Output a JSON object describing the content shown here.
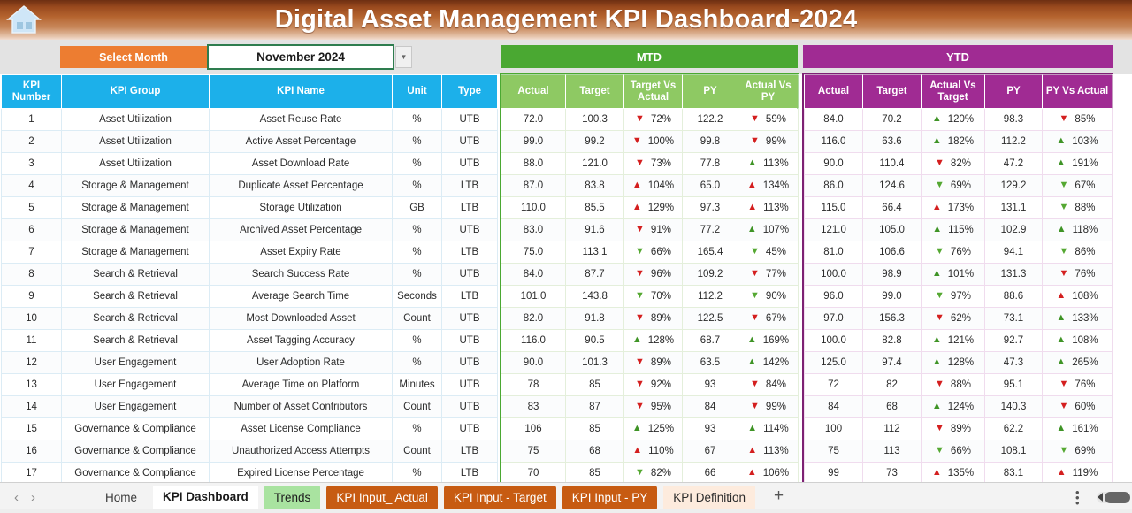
{
  "header": {
    "title": "Digital Asset Management KPI Dashboard-2024",
    "home_icon": "home-icon",
    "accent_color": "#b5642f"
  },
  "controls": {
    "select_month_label": "Select Month",
    "month_value": "November 2024",
    "dropdown_icon": "chevron-down-icon"
  },
  "groups": {
    "mtd": {
      "label": "MTD",
      "color": "#4aa832"
    },
    "ytd": {
      "label": "YTD",
      "color": "#a02b93"
    }
  },
  "left_headers": [
    "KPI Number",
    "KPI Group",
    "KPI Name",
    "Unit",
    "Type"
  ],
  "mtd_headers": [
    "Actual",
    "Target",
    "Target Vs Actual",
    "PY",
    "Actual Vs PY"
  ],
  "ytd_headers": [
    "Actual",
    "Target",
    "Actual Vs Target",
    "PY",
    "PY Vs Actual"
  ],
  "rows": [
    {
      "num": "1",
      "group": "Asset Utilization",
      "name": "Asset Reuse Rate",
      "unit": "%",
      "type": "UTB",
      "mtd": {
        "actual": "72.0",
        "target": "100.3",
        "tva": "72%",
        "tva_dir": "down",
        "tva_color": "red",
        "py": "122.2",
        "avp": "59%",
        "avp_dir": "down",
        "avp_color": "red"
      },
      "ytd": {
        "actual": "84.0",
        "target": "70.2",
        "avt": "120%",
        "avt_dir": "up",
        "avt_color": "green",
        "py": "98.3",
        "pva": "85%",
        "pva_dir": "down",
        "pva_color": "red"
      }
    },
    {
      "num": "2",
      "group": "Asset Utilization",
      "name": "Active Asset Percentage",
      "unit": "%",
      "type": "UTB",
      "mtd": {
        "actual": "99.0",
        "target": "99.2",
        "tva": "100%",
        "tva_dir": "down",
        "tva_color": "red",
        "py": "99.8",
        "avp": "99%",
        "avp_dir": "down",
        "avp_color": "red"
      },
      "ytd": {
        "actual": "116.0",
        "target": "63.6",
        "avt": "182%",
        "avt_dir": "up",
        "avt_color": "green",
        "py": "112.2",
        "pva": "103%",
        "pva_dir": "up",
        "pva_color": "green"
      }
    },
    {
      "num": "3",
      "group": "Asset Utilization",
      "name": "Asset Download Rate",
      "unit": "%",
      "type": "UTB",
      "mtd": {
        "actual": "88.0",
        "target": "121.0",
        "tva": "73%",
        "tva_dir": "down",
        "tva_color": "red",
        "py": "77.8",
        "avp": "113%",
        "avp_dir": "up",
        "avp_color": "green"
      },
      "ytd": {
        "actual": "90.0",
        "target": "110.4",
        "avt": "82%",
        "avt_dir": "down",
        "avt_color": "red",
        "py": "47.2",
        "pva": "191%",
        "pva_dir": "up",
        "pva_color": "green"
      }
    },
    {
      "num": "4",
      "group": "Storage & Management",
      "name": "Duplicate Asset Percentage",
      "unit": "%",
      "type": "LTB",
      "mtd": {
        "actual": "87.0",
        "target": "83.8",
        "tva": "104%",
        "tva_dir": "up",
        "tva_color": "red",
        "py": "65.0",
        "avp": "134%",
        "avp_dir": "up",
        "avp_color": "red"
      },
      "ytd": {
        "actual": "86.0",
        "target": "124.6",
        "avt": "69%",
        "avt_dir": "down",
        "avt_color": "green",
        "py": "129.2",
        "pva": "67%",
        "pva_dir": "down",
        "pva_color": "green"
      }
    },
    {
      "num": "5",
      "group": "Storage & Management",
      "name": "Storage Utilization",
      "unit": "GB",
      "type": "LTB",
      "mtd": {
        "actual": "110.0",
        "target": "85.5",
        "tva": "129%",
        "tva_dir": "up",
        "tva_color": "red",
        "py": "97.3",
        "avp": "113%",
        "avp_dir": "up",
        "avp_color": "red"
      },
      "ytd": {
        "actual": "115.0",
        "target": "66.4",
        "avt": "173%",
        "avt_dir": "up",
        "avt_color": "red",
        "py": "131.1",
        "pva": "88%",
        "pva_dir": "down",
        "pva_color": "green"
      }
    },
    {
      "num": "6",
      "group": "Storage & Management",
      "name": "Archived Asset Percentage",
      "unit": "%",
      "type": "UTB",
      "mtd": {
        "actual": "83.0",
        "target": "91.6",
        "tva": "91%",
        "tva_dir": "down",
        "tva_color": "red",
        "py": "77.2",
        "avp": "107%",
        "avp_dir": "up",
        "avp_color": "green"
      },
      "ytd": {
        "actual": "121.0",
        "target": "105.0",
        "avt": "115%",
        "avt_dir": "up",
        "avt_color": "green",
        "py": "102.9",
        "pva": "118%",
        "pva_dir": "up",
        "pva_color": "green"
      }
    },
    {
      "num": "7",
      "group": "Storage & Management",
      "name": "Asset Expiry Rate",
      "unit": "%",
      "type": "LTB",
      "mtd": {
        "actual": "75.0",
        "target": "113.1",
        "tva": "66%",
        "tva_dir": "down",
        "tva_color": "green",
        "py": "165.4",
        "avp": "45%",
        "avp_dir": "down",
        "avp_color": "green"
      },
      "ytd": {
        "actual": "81.0",
        "target": "106.6",
        "avt": "76%",
        "avt_dir": "down",
        "avt_color": "green",
        "py": "94.1",
        "pva": "86%",
        "pva_dir": "down",
        "pva_color": "green"
      }
    },
    {
      "num": "8",
      "group": "Search & Retrieval",
      "name": "Search Success Rate",
      "unit": "%",
      "type": "UTB",
      "mtd": {
        "actual": "84.0",
        "target": "87.7",
        "tva": "96%",
        "tva_dir": "down",
        "tva_color": "red",
        "py": "109.2",
        "avp": "77%",
        "avp_dir": "down",
        "avp_color": "red"
      },
      "ytd": {
        "actual": "100.0",
        "target": "98.9",
        "avt": "101%",
        "avt_dir": "up",
        "avt_color": "green",
        "py": "131.3",
        "pva": "76%",
        "pva_dir": "down",
        "pva_color": "red"
      }
    },
    {
      "num": "9",
      "group": "Search & Retrieval",
      "name": "Average Search Time",
      "unit": "Seconds",
      "type": "LTB",
      "mtd": {
        "actual": "101.0",
        "target": "143.8",
        "tva": "70%",
        "tva_dir": "down",
        "tva_color": "green",
        "py": "112.2",
        "avp": "90%",
        "avp_dir": "down",
        "avp_color": "green"
      },
      "ytd": {
        "actual": "96.0",
        "target": "99.0",
        "avt": "97%",
        "avt_dir": "down",
        "avt_color": "green",
        "py": "88.6",
        "pva": "108%",
        "pva_dir": "up",
        "pva_color": "red"
      }
    },
    {
      "num": "10",
      "group": "Search & Retrieval",
      "name": "Most Downloaded Asset",
      "unit": "Count",
      "type": "UTB",
      "mtd": {
        "actual": "82.0",
        "target": "91.8",
        "tva": "89%",
        "tva_dir": "down",
        "tva_color": "red",
        "py": "122.5",
        "avp": "67%",
        "avp_dir": "down",
        "avp_color": "red"
      },
      "ytd": {
        "actual": "97.0",
        "target": "156.3",
        "avt": "62%",
        "avt_dir": "down",
        "avt_color": "red",
        "py": "73.1",
        "pva": "133%",
        "pva_dir": "up",
        "pva_color": "green"
      }
    },
    {
      "num": "11",
      "group": "Search & Retrieval",
      "name": "Asset Tagging Accuracy",
      "unit": "%",
      "type": "UTB",
      "mtd": {
        "actual": "116.0",
        "target": "90.5",
        "tva": "128%",
        "tva_dir": "up",
        "tva_color": "green",
        "py": "68.7",
        "avp": "169%",
        "avp_dir": "up",
        "avp_color": "green"
      },
      "ytd": {
        "actual": "100.0",
        "target": "82.8",
        "avt": "121%",
        "avt_dir": "up",
        "avt_color": "green",
        "py": "92.7",
        "pva": "108%",
        "pva_dir": "up",
        "pva_color": "green"
      }
    },
    {
      "num": "12",
      "group": "User Engagement",
      "name": "User Adoption Rate",
      "unit": "%",
      "type": "UTB",
      "mtd": {
        "actual": "90.0",
        "target": "101.3",
        "tva": "89%",
        "tva_dir": "down",
        "tva_color": "red",
        "py": "63.5",
        "avp": "142%",
        "avp_dir": "up",
        "avp_color": "green"
      },
      "ytd": {
        "actual": "125.0",
        "target": "97.4",
        "avt": "128%",
        "avt_dir": "up",
        "avt_color": "green",
        "py": "47.3",
        "pva": "265%",
        "pva_dir": "up",
        "pva_color": "green"
      }
    },
    {
      "num": "13",
      "group": "User Engagement",
      "name": "Average Time on Platform",
      "unit": "Minutes",
      "type": "UTB",
      "mtd": {
        "actual": "78",
        "target": "85",
        "tva": "92%",
        "tva_dir": "down",
        "tva_color": "red",
        "py": "93",
        "avp": "84%",
        "avp_dir": "down",
        "avp_color": "red"
      },
      "ytd": {
        "actual": "72",
        "target": "82",
        "avt": "88%",
        "avt_dir": "down",
        "avt_color": "red",
        "py": "95.1",
        "pva": "76%",
        "pva_dir": "down",
        "pva_color": "red"
      }
    },
    {
      "num": "14",
      "group": "User Engagement",
      "name": "Number of Asset Contributors",
      "unit": "Count",
      "type": "UTB",
      "mtd": {
        "actual": "83",
        "target": "87",
        "tva": "95%",
        "tva_dir": "down",
        "tva_color": "red",
        "py": "84",
        "avp": "99%",
        "avp_dir": "down",
        "avp_color": "red"
      },
      "ytd": {
        "actual": "84",
        "target": "68",
        "avt": "124%",
        "avt_dir": "up",
        "avt_color": "green",
        "py": "140.3",
        "pva": "60%",
        "pva_dir": "down",
        "pva_color": "red"
      }
    },
    {
      "num": "15",
      "group": "Governance & Compliance",
      "name": "Asset License Compliance",
      "unit": "%",
      "type": "UTB",
      "mtd": {
        "actual": "106",
        "target": "85",
        "tva": "125%",
        "tva_dir": "up",
        "tva_color": "green",
        "py": "93",
        "avp": "114%",
        "avp_dir": "up",
        "avp_color": "green"
      },
      "ytd": {
        "actual": "100",
        "target": "112",
        "avt": "89%",
        "avt_dir": "down",
        "avt_color": "red",
        "py": "62.2",
        "pva": "161%",
        "pva_dir": "up",
        "pva_color": "green"
      }
    },
    {
      "num": "16",
      "group": "Governance & Compliance",
      "name": "Unauthorized Access Attempts",
      "unit": "Count",
      "type": "LTB",
      "mtd": {
        "actual": "75",
        "target": "68",
        "tva": "110%",
        "tva_dir": "up",
        "tva_color": "red",
        "py": "67",
        "avp": "113%",
        "avp_dir": "up",
        "avp_color": "red"
      },
      "ytd": {
        "actual": "75",
        "target": "113",
        "avt": "66%",
        "avt_dir": "down",
        "avt_color": "green",
        "py": "108.1",
        "pva": "69%",
        "pva_dir": "down",
        "pva_color": "green"
      }
    },
    {
      "num": "17",
      "group": "Governance & Compliance",
      "name": "Expired License Percentage",
      "unit": "%",
      "type": "LTB",
      "mtd": {
        "actual": "70",
        "target": "85",
        "tva": "82%",
        "tva_dir": "down",
        "tva_color": "green",
        "py": "66",
        "avp": "106%",
        "avp_dir": "up",
        "avp_color": "red"
      },
      "ytd": {
        "actual": "99",
        "target": "73",
        "avt": "135%",
        "avt_dir": "up",
        "avt_color": "red",
        "py": "83.1",
        "pva": "119%",
        "pva_dir": "up",
        "pva_color": "red"
      }
    }
  ],
  "sheet_bar": {
    "prev_icon": "chevron-left-icon",
    "next_icon": "chevron-right-icon",
    "tabs": [
      {
        "label": "Home",
        "style": "plain"
      },
      {
        "label": "KPI Dashboard",
        "style": "active"
      },
      {
        "label": "Trends",
        "style": "green"
      },
      {
        "label": "KPI Input_ Actual",
        "style": "orange"
      },
      {
        "label": "KPI Input - Target",
        "style": "orange"
      },
      {
        "label": "KPI Input - PY",
        "style": "orange"
      },
      {
        "label": "KPI Definition",
        "style": "peach"
      }
    ],
    "add_label": "+",
    "menu_icon": "kebab-menu-icon",
    "scrollbar_icon": "horizontal-scrollbar"
  }
}
